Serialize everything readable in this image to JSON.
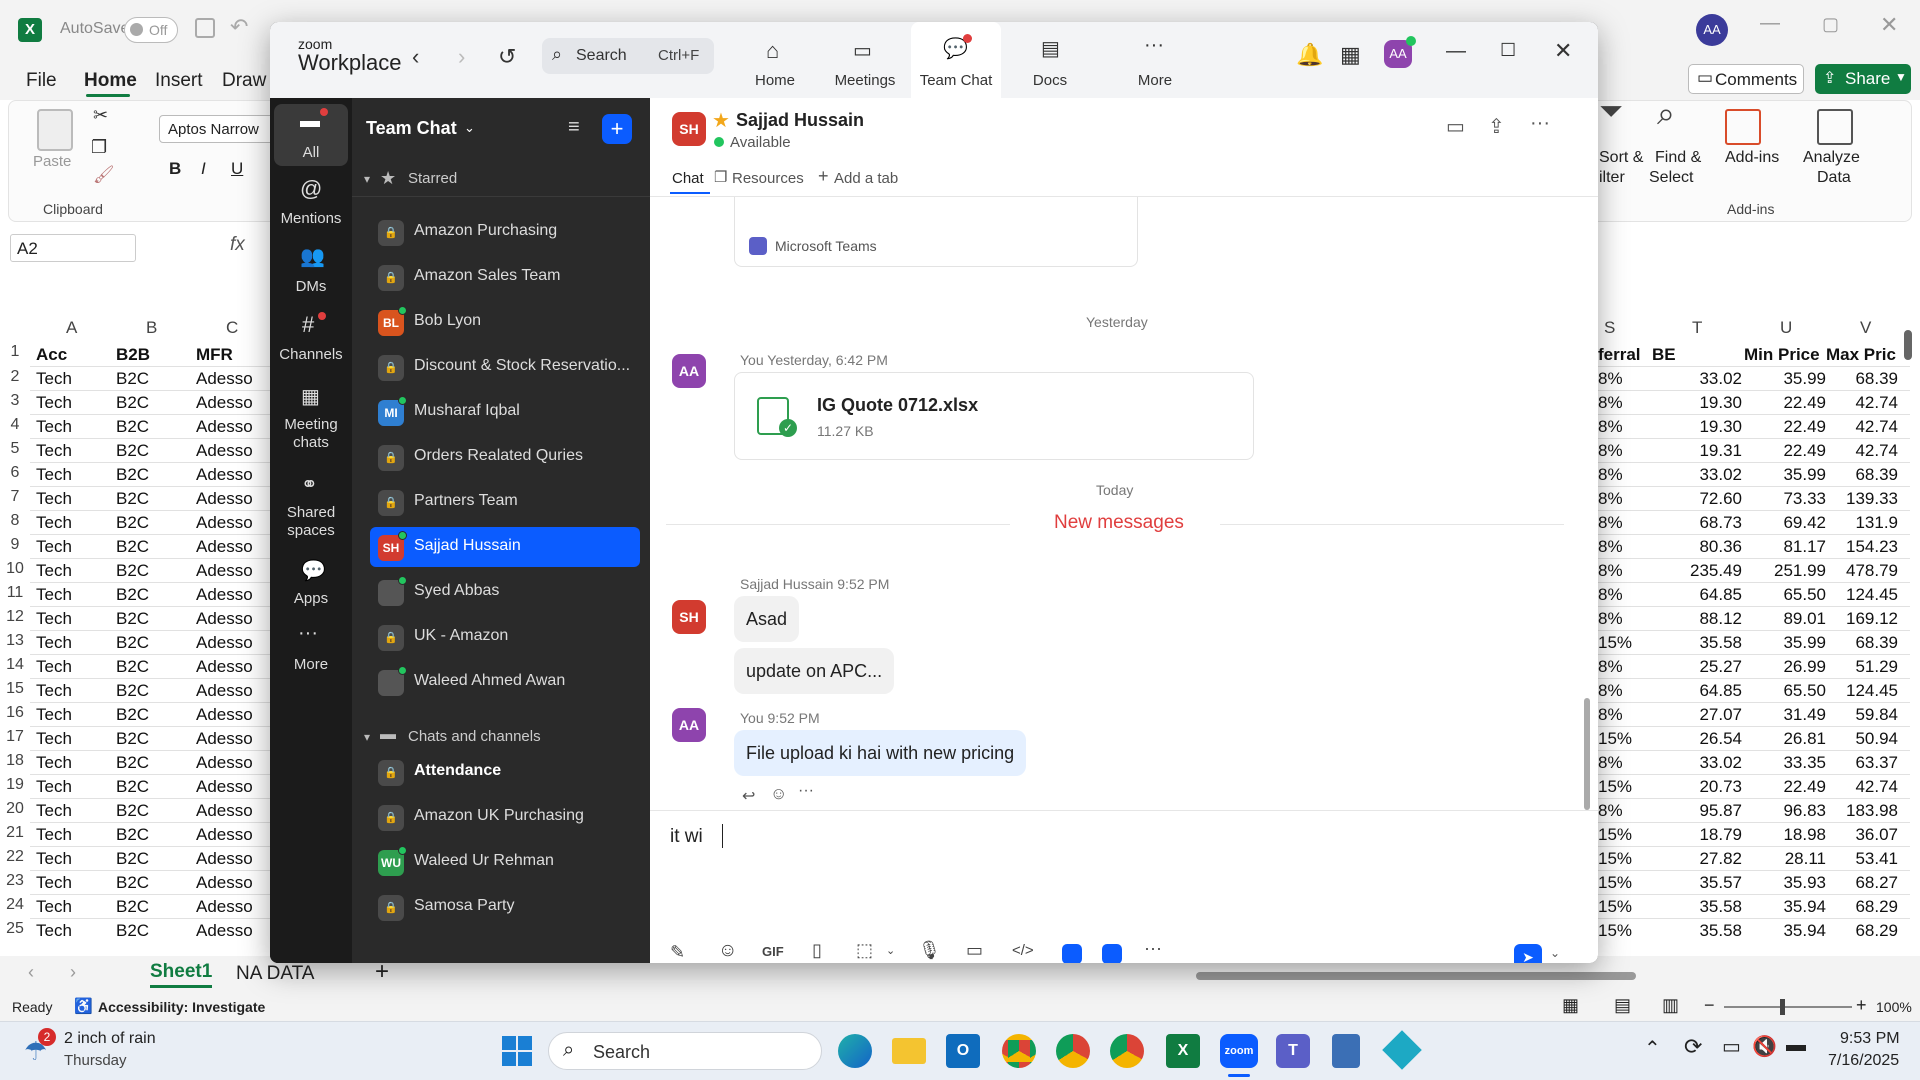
{
  "excel": {
    "autosave_label": "AutoSave",
    "autosave_state": "Off",
    "tabs": [
      "File",
      "Home",
      "Insert",
      "Draw"
    ],
    "comments_label": "Comments",
    "share_label": "Share",
    "font_name": "Aptos Narrow",
    "name_box": "A2",
    "paste_label": "Paste",
    "clipboard_label": "Clipboard",
    "sort_filter_label": "Sort & Filter",
    "sort_filter_short": "Sort &",
    "filter_short": "ilter",
    "find_select_1": "Find &",
    "find_select_2": "Select",
    "addins_label": "Add-ins",
    "addins_group": "Add-ins",
    "analyze_1": "Analyze",
    "analyze_2": "Data",
    "col_letters_left": [
      "A",
      "B",
      "C"
    ],
    "col_letters_right": [
      "S",
      "T",
      "U",
      "V"
    ],
    "header_left": [
      "Acc",
      "B2B",
      "MFR"
    ],
    "header_right": [
      "ferral",
      "BE",
      "Min Price",
      "Max Pric"
    ],
    "rows": [
      {
        "n": "2",
        "a": "Tech",
        "b": "B2C",
        "c": "Adesso",
        "s": "8%",
        "t": "33.02",
        "u": "35.99",
        "v": "68.39"
      },
      {
        "n": "3",
        "a": "Tech",
        "b": "B2C",
        "c": "Adesso",
        "s": "8%",
        "t": "19.30",
        "u": "22.49",
        "v": "42.74"
      },
      {
        "n": "4",
        "a": "Tech",
        "b": "B2C",
        "c": "Adesso",
        "s": "8%",
        "t": "19.30",
        "u": "22.49",
        "v": "42.74"
      },
      {
        "n": "5",
        "a": "Tech",
        "b": "B2C",
        "c": "Adesso",
        "s": "8%",
        "t": "19.31",
        "u": "22.49",
        "v": "42.74"
      },
      {
        "n": "6",
        "a": "Tech",
        "b": "B2C",
        "c": "Adesso",
        "s": "8%",
        "t": "33.02",
        "u": "35.99",
        "v": "68.39"
      },
      {
        "n": "7",
        "a": "Tech",
        "b": "B2C",
        "c": "Adesso",
        "s": "8%",
        "t": "72.60",
        "u": "73.33",
        "v": "139.33"
      },
      {
        "n": "8",
        "a": "Tech",
        "b": "B2C",
        "c": "Adesso",
        "s": "8%",
        "t": "68.73",
        "u": "69.42",
        "v": "131.9"
      },
      {
        "n": "9",
        "a": "Tech",
        "b": "B2C",
        "c": "Adesso",
        "s": "8%",
        "t": "80.36",
        "u": "81.17",
        "v": "154.23"
      },
      {
        "n": "10",
        "a": "Tech",
        "b": "B2C",
        "c": "Adesso",
        "s": "8%",
        "t": "235.49",
        "u": "251.99",
        "v": "478.79"
      },
      {
        "n": "11",
        "a": "Tech",
        "b": "B2C",
        "c": "Adesso",
        "s": "8%",
        "t": "64.85",
        "u": "65.50",
        "v": "124.45"
      },
      {
        "n": "12",
        "a": "Tech",
        "b": "B2C",
        "c": "Adesso",
        "s": "8%",
        "t": "88.12",
        "u": "89.01",
        "v": "169.12"
      },
      {
        "n": "13",
        "a": "Tech",
        "b": "B2C",
        "c": "Adesso",
        "s": "15%",
        "t": "35.58",
        "u": "35.99",
        "v": "68.39"
      },
      {
        "n": "14",
        "a": "Tech",
        "b": "B2C",
        "c": "Adesso",
        "s": "8%",
        "t": "25.27",
        "u": "26.99",
        "v": "51.29"
      },
      {
        "n": "15",
        "a": "Tech",
        "b": "B2C",
        "c": "Adesso",
        "s": "8%",
        "t": "64.85",
        "u": "65.50",
        "v": "124.45"
      },
      {
        "n": "16",
        "a": "Tech",
        "b": "B2C",
        "c": "Adesso",
        "s": "8%",
        "t": "27.07",
        "u": "31.49",
        "v": "59.84"
      },
      {
        "n": "17",
        "a": "Tech",
        "b": "B2C",
        "c": "Adesso",
        "s": "15%",
        "t": "26.54",
        "u": "26.81",
        "v": "50.94"
      },
      {
        "n": "18",
        "a": "Tech",
        "b": "B2C",
        "c": "Adesso",
        "s": "8%",
        "t": "33.02",
        "u": "33.35",
        "v": "63.37"
      },
      {
        "n": "19",
        "a": "Tech",
        "b": "B2C",
        "c": "Adesso",
        "s": "15%",
        "t": "20.73",
        "u": "22.49",
        "v": "42.74"
      },
      {
        "n": "20",
        "a": "Tech",
        "b": "B2C",
        "c": "Adesso",
        "s": "8%",
        "t": "95.87",
        "u": "96.83",
        "v": "183.98"
      },
      {
        "n": "21",
        "a": "Tech",
        "b": "B2C",
        "c": "Adesso",
        "s": "15%",
        "t": "18.79",
        "u": "18.98",
        "v": "36.07"
      },
      {
        "n": "22",
        "a": "Tech",
        "b": "B2C",
        "c": "Adesso",
        "s": "15%",
        "t": "27.82",
        "u": "28.11",
        "v": "53.41"
      },
      {
        "n": "23",
        "a": "Tech",
        "b": "B2C",
        "c": "Adesso",
        "s": "15%",
        "t": "35.57",
        "u": "35.93",
        "v": "68.27"
      },
      {
        "n": "24",
        "a": "Tech",
        "b": "B2C",
        "c": "Adesso",
        "s": "15%",
        "t": "35.58",
        "u": "35.94",
        "v": "68.29"
      },
      {
        "n": "25",
        "a": "Tech",
        "b": "B2C",
        "c": "Adesso",
        "s": "15%",
        "t": "35.58",
        "u": "35.94",
        "v": "68.29"
      }
    ],
    "sheets": [
      "Sheet1",
      "NA DATA"
    ],
    "status_ready": "Ready",
    "status_accessibility": "Accessibility: Investigate",
    "zoom_level": "100%"
  },
  "zoom": {
    "brand_small": "zoom",
    "brand_large": "Workplace",
    "search_placeholder": "Search",
    "search_shortcut": "Ctrl+F",
    "nav": [
      "Home",
      "Meetings",
      "Team Chat",
      "Docs",
      "More"
    ],
    "active_nav": "Team Chat",
    "profile_initials": "AA",
    "rail": [
      {
        "label": "All",
        "icon": "chat-bubble-icon"
      },
      {
        "label": "Mentions",
        "icon": "at-icon"
      },
      {
        "label": "DMs",
        "icon": "people-icon"
      },
      {
        "label": "Channels",
        "icon": "hash-icon"
      },
      {
        "label": "Meeting",
        "label2": "chats",
        "icon": "calendar-icon"
      },
      {
        "label": "Shared",
        "label2": "spaces",
        "icon": "share-icon"
      },
      {
        "label": "Apps",
        "icon": "apps-icon"
      },
      {
        "label": "More",
        "icon": "more-icon"
      }
    ],
    "list_title": "Team Chat",
    "section_starred": "Starred",
    "section_chats": "Chats and channels",
    "starred_items": [
      {
        "name": "Amazon Purchasing",
        "type": "lock"
      },
      {
        "name": "Amazon Sales Team",
        "type": "lock"
      },
      {
        "name": "Bob Lyon",
        "type": "avatar",
        "initials": "BL",
        "color": "#d9541e"
      },
      {
        "name": "Discount & Stock Reservatio...",
        "type": "lock"
      },
      {
        "name": "Musharaf Iqbal",
        "type": "avatar",
        "initials": "MI",
        "color": "#2f7fd1"
      },
      {
        "name": "Orders Realated Quries",
        "type": "lock"
      },
      {
        "name": "Partners Team",
        "type": "lock"
      },
      {
        "name": "Sajjad Hussain",
        "type": "avatar",
        "initials": "SH",
        "color": "#d23b2f"
      },
      {
        "name": "Syed Abbas",
        "type": "photo"
      },
      {
        "name": "UK - Amazon",
        "type": "lock"
      },
      {
        "name": "Waleed Ahmed Awan",
        "type": "photo"
      }
    ],
    "chat_items": [
      {
        "name": "Attendance",
        "type": "lock"
      },
      {
        "name": "Amazon UK Purchasing",
        "type": "lock"
      },
      {
        "name": "Waleed Ur Rehman",
        "type": "avatar",
        "initials": "WU",
        "color": "#2e9e4f"
      },
      {
        "name": "Samosa Party",
        "type": "lock"
      }
    ],
    "contact": {
      "name": "Sajjad Hussain",
      "initials": "SH",
      "status": "Available"
    },
    "chat_tabs": [
      "Chat",
      "Resources",
      "Add a tab"
    ],
    "teams_label": "Microsoft Teams",
    "day_yesterday": "Yesterday",
    "day_today": "Today",
    "msg1_meta": "You Yesterday, 6:42 PM",
    "file_name": "IG Quote 0712.xlsx",
    "file_size": "11.27 KB",
    "new_messages": "New messages",
    "msg2_meta": "Sajjad Hussain 9:52 PM",
    "msg2_lines": [
      "Asad",
      "update on APC..."
    ],
    "msg3_meta": "You 9:52 PM",
    "msg3_text": "File upload ki hai with new pricing",
    "composer_text": "it wi",
    "gif_label": "GIF",
    "colors": {
      "accent": "#0b5cff",
      "new_messages": "#e03e3e",
      "self_bubble": "#e5f0ff",
      "other_bubble": "#f1f1f1",
      "my_avatar": "#8e44ad"
    }
  },
  "taskbar": {
    "weather_line1": "2 inch of rain",
    "weather_line2": "Thursday",
    "weather_badge": "2",
    "search_label": "Search",
    "time": "9:53 PM",
    "date": "7/16/2025"
  }
}
